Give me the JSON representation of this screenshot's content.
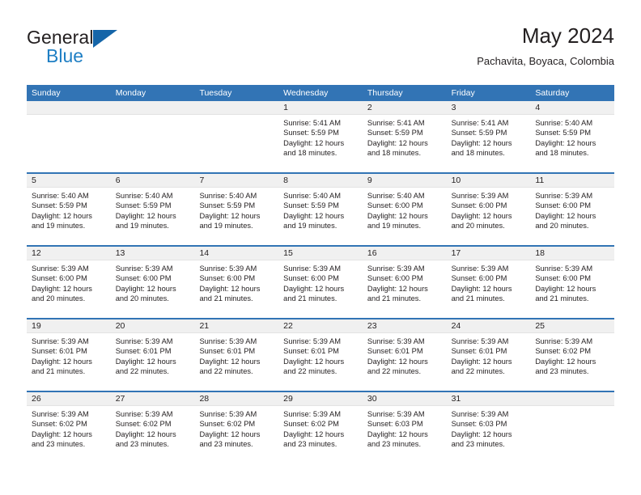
{
  "brand": {
    "line1": "General",
    "line2": "Blue",
    "triangle_color": "#1565a8",
    "blue_color": "#1f7fc4"
  },
  "header": {
    "title": "May 2024",
    "subtitle": "Pachavita, Boyaca, Colombia"
  },
  "theme": {
    "header_band": "#3274b5",
    "day_band": "#f0f0f0",
    "text": "#231f20"
  },
  "weekdays": [
    "Sunday",
    "Monday",
    "Tuesday",
    "Wednesday",
    "Thursday",
    "Friday",
    "Saturday"
  ],
  "weeks": [
    [
      {
        "day": "",
        "empty": true,
        "sunrise": "",
        "sunset": "",
        "daylight1": "",
        "daylight2": ""
      },
      {
        "day": "",
        "empty": true,
        "sunrise": "",
        "sunset": "",
        "daylight1": "",
        "daylight2": ""
      },
      {
        "day": "",
        "empty": true,
        "sunrise": "",
        "sunset": "",
        "daylight1": "",
        "daylight2": ""
      },
      {
        "day": "1",
        "empty": false,
        "sunrise": "Sunrise: 5:41 AM",
        "sunset": "Sunset: 5:59 PM",
        "daylight1": "Daylight: 12 hours",
        "daylight2": "and 18 minutes."
      },
      {
        "day": "2",
        "empty": false,
        "sunrise": "Sunrise: 5:41 AM",
        "sunset": "Sunset: 5:59 PM",
        "daylight1": "Daylight: 12 hours",
        "daylight2": "and 18 minutes."
      },
      {
        "day": "3",
        "empty": false,
        "sunrise": "Sunrise: 5:41 AM",
        "sunset": "Sunset: 5:59 PM",
        "daylight1": "Daylight: 12 hours",
        "daylight2": "and 18 minutes."
      },
      {
        "day": "4",
        "empty": false,
        "sunrise": "Sunrise: 5:40 AM",
        "sunset": "Sunset: 5:59 PM",
        "daylight1": "Daylight: 12 hours",
        "daylight2": "and 18 minutes."
      }
    ],
    [
      {
        "day": "5",
        "empty": false,
        "sunrise": "Sunrise: 5:40 AM",
        "sunset": "Sunset: 5:59 PM",
        "daylight1": "Daylight: 12 hours",
        "daylight2": "and 19 minutes."
      },
      {
        "day": "6",
        "empty": false,
        "sunrise": "Sunrise: 5:40 AM",
        "sunset": "Sunset: 5:59 PM",
        "daylight1": "Daylight: 12 hours",
        "daylight2": "and 19 minutes."
      },
      {
        "day": "7",
        "empty": false,
        "sunrise": "Sunrise: 5:40 AM",
        "sunset": "Sunset: 5:59 PM",
        "daylight1": "Daylight: 12 hours",
        "daylight2": "and 19 minutes."
      },
      {
        "day": "8",
        "empty": false,
        "sunrise": "Sunrise: 5:40 AM",
        "sunset": "Sunset: 5:59 PM",
        "daylight1": "Daylight: 12 hours",
        "daylight2": "and 19 minutes."
      },
      {
        "day": "9",
        "empty": false,
        "sunrise": "Sunrise: 5:40 AM",
        "sunset": "Sunset: 6:00 PM",
        "daylight1": "Daylight: 12 hours",
        "daylight2": "and 19 minutes."
      },
      {
        "day": "10",
        "empty": false,
        "sunrise": "Sunrise: 5:39 AM",
        "sunset": "Sunset: 6:00 PM",
        "daylight1": "Daylight: 12 hours",
        "daylight2": "and 20 minutes."
      },
      {
        "day": "11",
        "empty": false,
        "sunrise": "Sunrise: 5:39 AM",
        "sunset": "Sunset: 6:00 PM",
        "daylight1": "Daylight: 12 hours",
        "daylight2": "and 20 minutes."
      }
    ],
    [
      {
        "day": "12",
        "empty": false,
        "sunrise": "Sunrise: 5:39 AM",
        "sunset": "Sunset: 6:00 PM",
        "daylight1": "Daylight: 12 hours",
        "daylight2": "and 20 minutes."
      },
      {
        "day": "13",
        "empty": false,
        "sunrise": "Sunrise: 5:39 AM",
        "sunset": "Sunset: 6:00 PM",
        "daylight1": "Daylight: 12 hours",
        "daylight2": "and 20 minutes."
      },
      {
        "day": "14",
        "empty": false,
        "sunrise": "Sunrise: 5:39 AM",
        "sunset": "Sunset: 6:00 PM",
        "daylight1": "Daylight: 12 hours",
        "daylight2": "and 21 minutes."
      },
      {
        "day": "15",
        "empty": false,
        "sunrise": "Sunrise: 5:39 AM",
        "sunset": "Sunset: 6:00 PM",
        "daylight1": "Daylight: 12 hours",
        "daylight2": "and 21 minutes."
      },
      {
        "day": "16",
        "empty": false,
        "sunrise": "Sunrise: 5:39 AM",
        "sunset": "Sunset: 6:00 PM",
        "daylight1": "Daylight: 12 hours",
        "daylight2": "and 21 minutes."
      },
      {
        "day": "17",
        "empty": false,
        "sunrise": "Sunrise: 5:39 AM",
        "sunset": "Sunset: 6:00 PM",
        "daylight1": "Daylight: 12 hours",
        "daylight2": "and 21 minutes."
      },
      {
        "day": "18",
        "empty": false,
        "sunrise": "Sunrise: 5:39 AM",
        "sunset": "Sunset: 6:00 PM",
        "daylight1": "Daylight: 12 hours",
        "daylight2": "and 21 minutes."
      }
    ],
    [
      {
        "day": "19",
        "empty": false,
        "sunrise": "Sunrise: 5:39 AM",
        "sunset": "Sunset: 6:01 PM",
        "daylight1": "Daylight: 12 hours",
        "daylight2": "and 21 minutes."
      },
      {
        "day": "20",
        "empty": false,
        "sunrise": "Sunrise: 5:39 AM",
        "sunset": "Sunset: 6:01 PM",
        "daylight1": "Daylight: 12 hours",
        "daylight2": "and 22 minutes."
      },
      {
        "day": "21",
        "empty": false,
        "sunrise": "Sunrise: 5:39 AM",
        "sunset": "Sunset: 6:01 PM",
        "daylight1": "Daylight: 12 hours",
        "daylight2": "and 22 minutes."
      },
      {
        "day": "22",
        "empty": false,
        "sunrise": "Sunrise: 5:39 AM",
        "sunset": "Sunset: 6:01 PM",
        "daylight1": "Daylight: 12 hours",
        "daylight2": "and 22 minutes."
      },
      {
        "day": "23",
        "empty": false,
        "sunrise": "Sunrise: 5:39 AM",
        "sunset": "Sunset: 6:01 PM",
        "daylight1": "Daylight: 12 hours",
        "daylight2": "and 22 minutes."
      },
      {
        "day": "24",
        "empty": false,
        "sunrise": "Sunrise: 5:39 AM",
        "sunset": "Sunset: 6:01 PM",
        "daylight1": "Daylight: 12 hours",
        "daylight2": "and 22 minutes."
      },
      {
        "day": "25",
        "empty": false,
        "sunrise": "Sunrise: 5:39 AM",
        "sunset": "Sunset: 6:02 PM",
        "daylight1": "Daylight: 12 hours",
        "daylight2": "and 23 minutes."
      }
    ],
    [
      {
        "day": "26",
        "empty": false,
        "sunrise": "Sunrise: 5:39 AM",
        "sunset": "Sunset: 6:02 PM",
        "daylight1": "Daylight: 12 hours",
        "daylight2": "and 23 minutes."
      },
      {
        "day": "27",
        "empty": false,
        "sunrise": "Sunrise: 5:39 AM",
        "sunset": "Sunset: 6:02 PM",
        "daylight1": "Daylight: 12 hours",
        "daylight2": "and 23 minutes."
      },
      {
        "day": "28",
        "empty": false,
        "sunrise": "Sunrise: 5:39 AM",
        "sunset": "Sunset: 6:02 PM",
        "daylight1": "Daylight: 12 hours",
        "daylight2": "and 23 minutes."
      },
      {
        "day": "29",
        "empty": false,
        "sunrise": "Sunrise: 5:39 AM",
        "sunset": "Sunset: 6:02 PM",
        "daylight1": "Daylight: 12 hours",
        "daylight2": "and 23 minutes."
      },
      {
        "day": "30",
        "empty": false,
        "sunrise": "Sunrise: 5:39 AM",
        "sunset": "Sunset: 6:03 PM",
        "daylight1": "Daylight: 12 hours",
        "daylight2": "and 23 minutes."
      },
      {
        "day": "31",
        "empty": false,
        "sunrise": "Sunrise: 5:39 AM",
        "sunset": "Sunset: 6:03 PM",
        "daylight1": "Daylight: 12 hours",
        "daylight2": "and 23 minutes."
      },
      {
        "day": "",
        "empty": true,
        "sunrise": "",
        "sunset": "",
        "daylight1": "",
        "daylight2": ""
      }
    ]
  ]
}
